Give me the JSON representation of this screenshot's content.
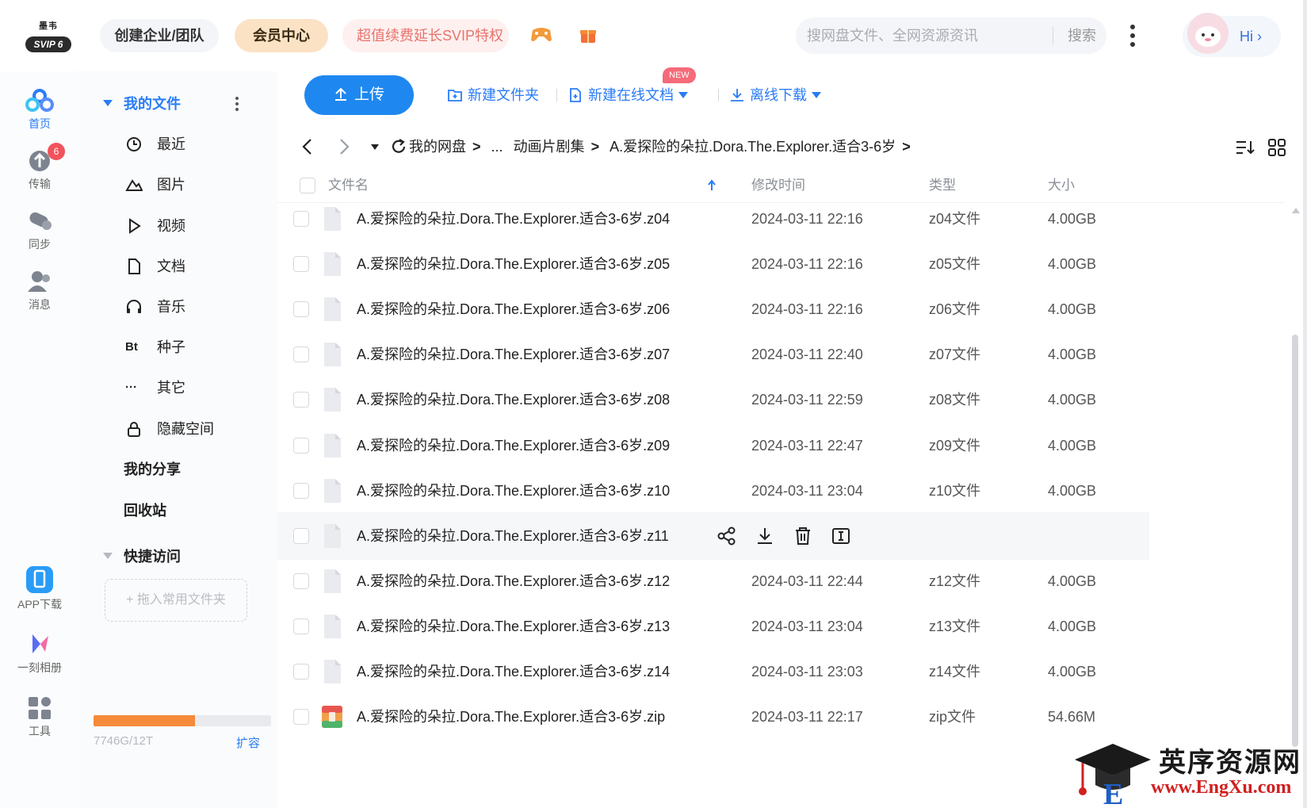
{
  "top": {
    "logo_text": "SVIP 6",
    "logo_top": "墨韦",
    "team_btn": "创建企业/团队",
    "vip_btn": "会员中心",
    "promo_btn": "超值续费延长SVIP特权",
    "search_placeholder": "搜网盘文件、全网资源资讯",
    "search_btn": "搜索",
    "hi": "Hi ›"
  },
  "rail": [
    {
      "label": "首页",
      "icon": "home-cloud-icon"
    },
    {
      "label": "传输",
      "icon": "transfer-icon",
      "badge": "6"
    },
    {
      "label": "同步",
      "icon": "sync-icon"
    },
    {
      "label": "消息",
      "icon": "message-icon"
    },
    {
      "label": "APP下载",
      "icon": "phone-icon"
    },
    {
      "label": "一刻相册",
      "icon": "album-icon"
    },
    {
      "label": "工具",
      "icon": "tools-icon"
    }
  ],
  "sidebar": {
    "my_files": "我的文件",
    "items": [
      {
        "label": "最近",
        "icon": "clock-icon"
      },
      {
        "label": "图片",
        "icon": "picture-icon"
      },
      {
        "label": "视频",
        "icon": "play-icon"
      },
      {
        "label": "文档",
        "icon": "document-icon"
      },
      {
        "label": "音乐",
        "icon": "headphones-icon"
      },
      {
        "label": "种子",
        "icon": "bt-icon",
        "glyph": "Bt"
      },
      {
        "label": "其它",
        "icon": "ellipsis-icon",
        "glyph": "···"
      },
      {
        "label": "隐藏空间",
        "icon": "lock-icon"
      }
    ],
    "my_share": "我的分享",
    "recycle": "回收站",
    "quick_access": "快捷访问",
    "drag_hint": "+ 拖入常用文件夹",
    "storage_text": "7746G/12T",
    "storage_fraction": 0.57,
    "expand": "扩容"
  },
  "toolbar": {
    "upload": "上传",
    "new_folder": "新建文件夹",
    "new_doc": "新建在线文档",
    "new_badge": "NEW",
    "offline": "离线下载"
  },
  "breadcrumb": [
    "我的网盘",
    "...",
    "动画片剧集",
    "A.爱探险的朵拉.Dora.The.Explorer.适合3-6岁"
  ],
  "table": {
    "headers": {
      "name": "文件名",
      "time": "修改时间",
      "type": "类型",
      "size": "大小"
    },
    "rows": [
      {
        "name": "A.爱探险的朵拉.Dora.The.Explorer.适合3-6岁.z04",
        "time": "2024-03-11 22:16",
        "type": "z04文件",
        "size": "4.00GB"
      },
      {
        "name": "A.爱探险的朵拉.Dora.The.Explorer.适合3-6岁.z05",
        "time": "2024-03-11 22:16",
        "type": "z05文件",
        "size": "4.00GB"
      },
      {
        "name": "A.爱探险的朵拉.Dora.The.Explorer.适合3-6岁.z06",
        "time": "2024-03-11 22:16",
        "type": "z06文件",
        "size": "4.00GB"
      },
      {
        "name": "A.爱探险的朵拉.Dora.The.Explorer.适合3-6岁.z07",
        "time": "2024-03-11 22:40",
        "type": "z07文件",
        "size": "4.00GB"
      },
      {
        "name": "A.爱探险的朵拉.Dora.The.Explorer.适合3-6岁.z08",
        "time": "2024-03-11 22:59",
        "type": "z08文件",
        "size": "4.00GB"
      },
      {
        "name": "A.爱探险的朵拉.Dora.The.Explorer.适合3-6岁.z09",
        "time": "2024-03-11 22:47",
        "type": "z09文件",
        "size": "4.00GB"
      },
      {
        "name": "A.爱探险的朵拉.Dora.The.Explorer.适合3-6岁.z10",
        "time": "2024-03-11 23:04",
        "type": "z10文件",
        "size": "4.00GB"
      },
      {
        "name": "A.爱探险的朵拉.Dora.The.Explorer.适合3-6岁.z11",
        "time": "",
        "type": "",
        "size": "",
        "hover": true
      },
      {
        "name": "A.爱探险的朵拉.Dora.The.Explorer.适合3-6岁.z12",
        "time": "2024-03-11 22:44",
        "type": "z12文件",
        "size": "4.00GB"
      },
      {
        "name": "A.爱探险的朵拉.Dora.The.Explorer.适合3-6岁.z13",
        "time": "2024-03-11 23:04",
        "type": "z13文件",
        "size": "4.00GB"
      },
      {
        "name": "A.爱探险的朵拉.Dora.The.Explorer.适合3-6岁.z14",
        "time": "2024-03-11 23:03",
        "type": "z14文件",
        "size": "4.00GB"
      },
      {
        "name": "A.爱探险的朵拉.Dora.The.Explorer.适合3-6岁.zip",
        "time": "2024-03-11 22:17",
        "type": "zip文件",
        "size": "54.66M",
        "zip": true
      }
    ]
  },
  "watermark": {
    "title": "英序资源网",
    "url": "www.EngXu.com"
  },
  "colors": {
    "accent": "#2a7cf6",
    "upload": "#1e88f0",
    "storage": "#f58a3a",
    "badge": "#f2535b"
  }
}
